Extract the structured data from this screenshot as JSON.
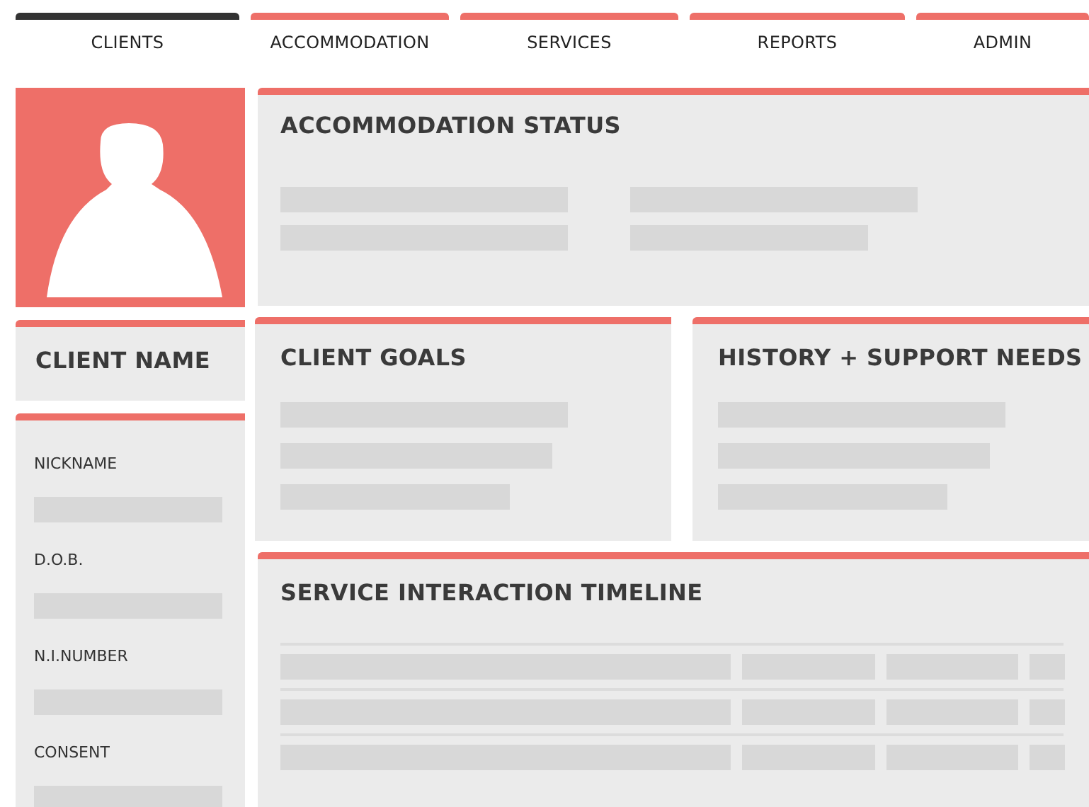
{
  "tabs": [
    {
      "label": "CLIENTS",
      "selected": true
    },
    {
      "label": "ACCOMMODATION",
      "selected": false
    },
    {
      "label": "SERVICES",
      "selected": false
    },
    {
      "label": "REPORTS",
      "selected": false
    },
    {
      "label": "ADMIN",
      "selected": false
    }
  ],
  "accommodation_status": {
    "title": "ACCOMMODATION STATUS"
  },
  "client_name": {
    "title": "CLIENT NAME"
  },
  "client_details": {
    "fields": [
      {
        "label": "NICKNAME"
      },
      {
        "label": "D.O.B."
      },
      {
        "label": "N.I.NUMBER"
      },
      {
        "label": "CONSENT"
      }
    ]
  },
  "client_goals": {
    "title": "CLIENT GOALS"
  },
  "history_support": {
    "title": "HISTORY + SUPPORT NEEDS"
  },
  "timeline": {
    "title": "SERVICE INTERACTION TIMELINE"
  }
}
